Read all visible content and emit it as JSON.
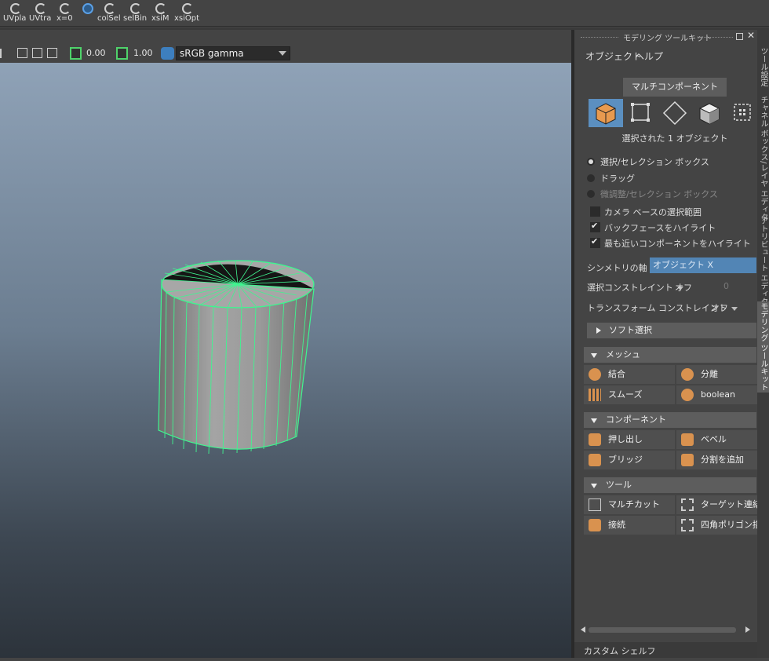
{
  "shelf": {
    "buttons": [
      "UVpla",
      "UVtra",
      "x=0",
      "",
      "colSel",
      "selBin",
      "xsiM",
      "xsiOpt"
    ]
  },
  "viewport_toolbar": {
    "exposure": "0.00",
    "gamma": "1.00",
    "color_space": "sRGB gamma"
  },
  "panel": {
    "title": "モデリング ツールキット",
    "menu": {
      "object": "オブジェクト",
      "help": "ヘルプ"
    },
    "multi_component": "マルチコンポーネント",
    "selection_modes": [
      "object-mode",
      "vertex-mode",
      "edge-mode",
      "face-mode",
      "uv-mode"
    ],
    "selected_count": "選択された 1 オブジェクト",
    "selection_options": [
      {
        "label": "選択/セレクション ボックス",
        "selected": true,
        "dim": false
      },
      {
        "label": "ドラッグ",
        "selected": false,
        "dim": false
      },
      {
        "label": "微調整/セレクション ボックス",
        "selected": false,
        "dim": true
      }
    ],
    "checkboxes": [
      {
        "label": "カメラ ベースの選択範囲",
        "checked": false
      },
      {
        "label": "バックフェースをハイライト",
        "checked": true
      },
      {
        "label": "最も近いコンポーネントをハイライト",
        "checked": true
      }
    ],
    "symmetry": {
      "label": "シンメトリの軸",
      "value": "オブジェクト X"
    },
    "select_constraint": {
      "label": "選択コンストレイント",
      "value": "オフ",
      "number": "0"
    },
    "transform_constraint": {
      "label": "トランスフォーム コンストレイント",
      "value": "オフ"
    },
    "soft_select": "ソフト選択",
    "sections": {
      "mesh": {
        "title": "メッシュ",
        "buttons": [
          "結合",
          "分離",
          "スムーズ",
          "boolean"
        ]
      },
      "component": {
        "title": "コンポーネント",
        "buttons": [
          "押し出し",
          "ベベル",
          "ブリッジ",
          "分割を追加"
        ]
      },
      "tools": {
        "title": "ツール",
        "buttons": [
          "マルチカット",
          "ターゲット連結",
          "接続",
          "四角ポリゴン描画"
        ]
      }
    },
    "custom_shelf": "カスタム シェルフ"
  },
  "vtabs": [
    "ツール設定",
    "チャネル ボックス/レイヤ エディタ",
    "アトリビュート エディタ",
    "モデリング ツールキット"
  ],
  "colors": {
    "accent": "#5b8fc0",
    "wire": "#3ff58f",
    "mesh_icon": "#d9924f"
  }
}
